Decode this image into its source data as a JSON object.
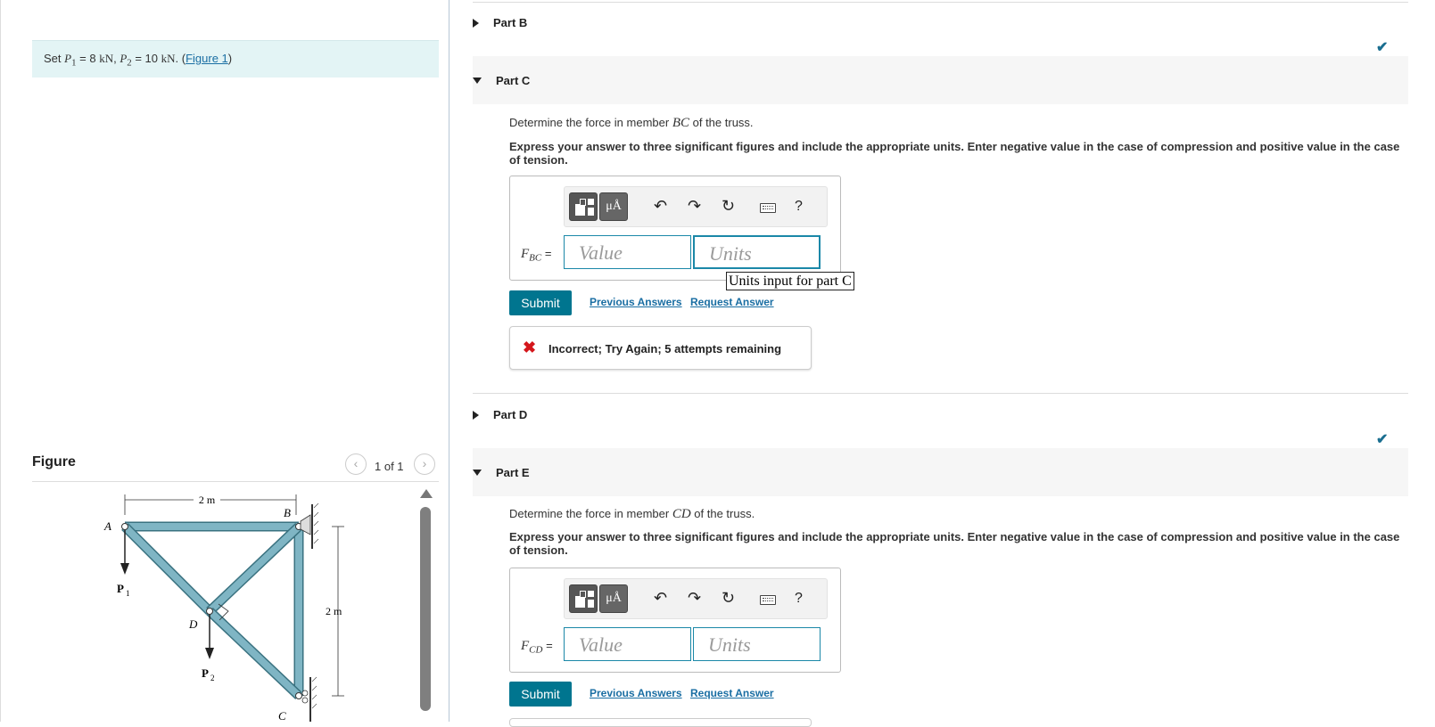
{
  "problem": {
    "set_prefix": "Set",
    "p1_symbol": "P",
    "p1_sub": "1",
    "p1_value": "= 8",
    "p1_unit": "kN",
    "p2_symbol": "P",
    "p2_sub": "2",
    "p2_value": "= 10",
    "p2_unit": "kN",
    "link_text": "Figure 1"
  },
  "figure": {
    "title": "Figure",
    "pager": "1 of 1",
    "labels": {
      "top_dim": "2 m",
      "side_dim": "2 m",
      "A": "A",
      "B": "B",
      "C": "C",
      "D": "D",
      "P": "P",
      "P1_sub": "1",
      "P2_sub": "2"
    }
  },
  "parts": {
    "b": {
      "label": "Part B"
    },
    "c": {
      "label": "Part C",
      "question_prefix": "Determine the force in member",
      "member": "BC",
      "question_suffix": "of the truss.",
      "instruction": "Express your answer to three significant figures and include the appropriate units. Enter negative value in the case of compression and positive value in the case of tension.",
      "var_symbol": "F",
      "var_sub": "BC",
      "value_placeholder": "Value",
      "units_placeholder": "Units",
      "tooltip": "Units input for part C",
      "submit": "Submit",
      "previous": "Previous Answers",
      "request": "Request Answer",
      "feedback": "Incorrect; Try Again; 5 attempts remaining"
    },
    "d": {
      "label": "Part D"
    },
    "e": {
      "label": "Part E",
      "question_prefix": "Determine the force in member",
      "member": "CD",
      "question_suffix": "of the truss.",
      "instruction": "Express your answer to three significant figures and include the appropriate units. Enter negative value in the case of compression and positive value in the case of tension.",
      "var_symbol": "F",
      "var_sub": "CD",
      "value_placeholder": "Value",
      "units_placeholder": "Units",
      "submit": "Submit",
      "previous": "Previous Answers",
      "request": "Request Answer"
    }
  },
  "toolbar": {
    "units_btn": "μÅ",
    "undo": "↶",
    "redo": "↷",
    "reset": "↻",
    "help": "?"
  },
  "colors": {
    "accent": "#00758f",
    "link": "#1a6ea3",
    "error": "#d4161b",
    "truss": "#7fb5c4"
  }
}
